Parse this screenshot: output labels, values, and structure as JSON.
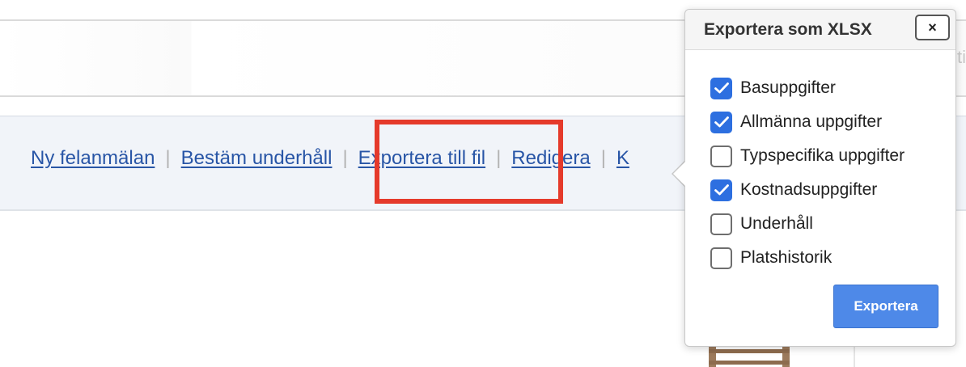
{
  "top_bar": {
    "ghost_text": "ti"
  },
  "actions": [
    {
      "label": "Ny felanmälan",
      "name": "action-ny-felanmalan"
    },
    {
      "label": "Bestäm underhåll",
      "name": "action-bestam-underhall"
    },
    {
      "label": "Exportera till fil",
      "name": "action-exportera-till-fil"
    },
    {
      "label": "Redigera",
      "name": "action-redigera"
    },
    {
      "label": "K",
      "name": "action-k-truncated"
    }
  ],
  "highlight": {
    "color": "#e53a2b",
    "target": "Exportera till fil"
  },
  "dialog": {
    "title": "Exportera som XLSX",
    "close_label": "×",
    "options": [
      {
        "label": "Basuppgifter",
        "checked": true
      },
      {
        "label": "Allmänna uppgifter",
        "checked": true
      },
      {
        "label": "Typspecifika uppgifter",
        "checked": false
      },
      {
        "label": "Kostnadsuppgifter",
        "checked": true
      },
      {
        "label": "Underhåll",
        "checked": false
      },
      {
        "label": "Platshistorik",
        "checked": false
      }
    ],
    "export_label": "Exportera"
  },
  "colors": {
    "link": "#2855a6",
    "checkbox_checked": "#2d6fe0",
    "export_button": "#4e89e8",
    "highlight": "#e53a2b"
  }
}
